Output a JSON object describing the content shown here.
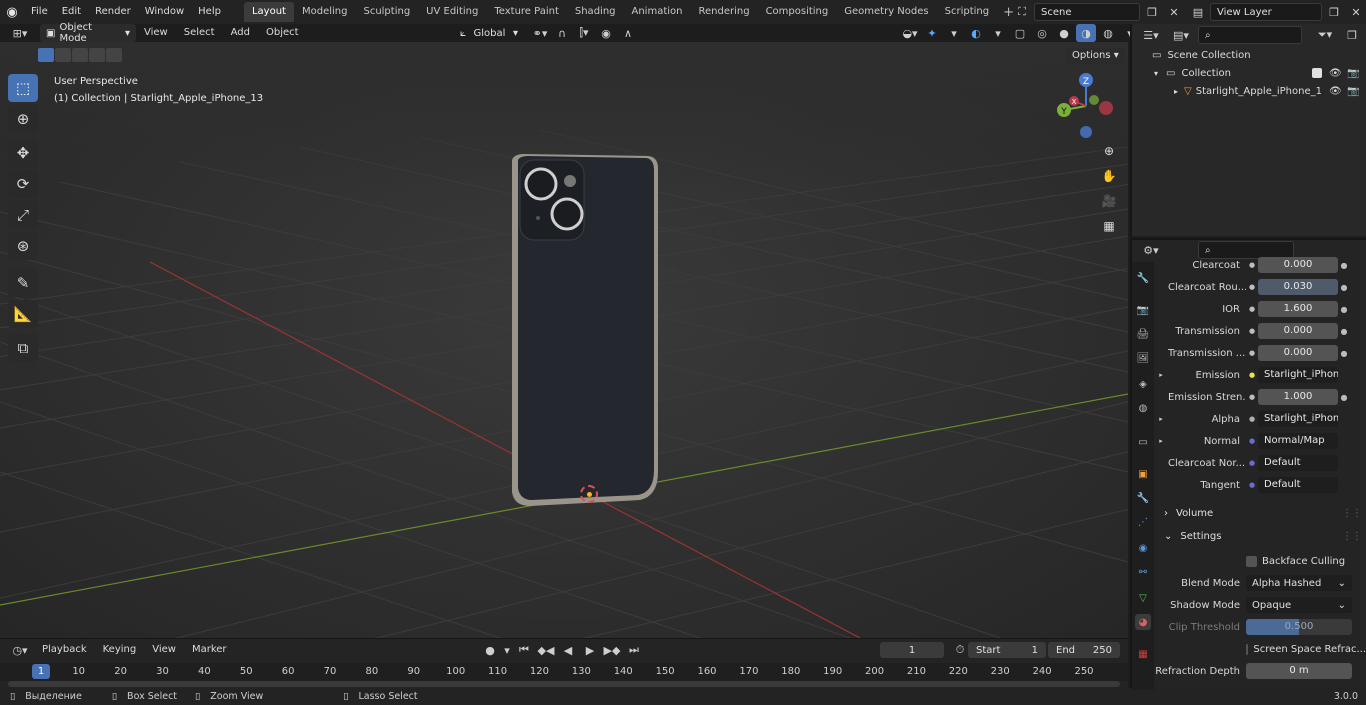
{
  "menu": [
    "File",
    "Edit",
    "Render",
    "Window",
    "Help"
  ],
  "workspaces": [
    "Layout",
    "Modeling",
    "Sculpting",
    "UV Editing",
    "Texture Paint",
    "Shading",
    "Animation",
    "Rendering",
    "Compositing",
    "Geometry Nodes",
    "Scripting"
  ],
  "active_workspace": "Layout",
  "scene_name": "Scene",
  "view_layer": "View Layer",
  "viewport": {
    "mode": "Object Mode",
    "menus": [
      "View",
      "Select",
      "Add",
      "Object"
    ],
    "transform": "Global",
    "options_label": "Options",
    "overlay_line1": "User Perspective",
    "overlay_line2": "(1) Collection | Starlight_Apple_iPhone_13",
    "gizmo": {
      "z": "Z",
      "y": "Y",
      "x": "X"
    }
  },
  "outliner": {
    "scene_collection": "Scene Collection",
    "collection": "Collection",
    "object": "Starlight_Apple_iPhone_1"
  },
  "properties": {
    "rows": [
      {
        "label": "Clearcoat",
        "value": "0.000",
        "kind": "num"
      },
      {
        "label": "Clearcoat Rou...",
        "value": "0.030",
        "kind": "num-hl"
      },
      {
        "label": "IOR",
        "value": "1.600",
        "kind": "num"
      },
      {
        "label": "Transmission",
        "value": "0.000",
        "kind": "num"
      },
      {
        "label": "Transmission ...",
        "value": "0.000",
        "kind": "num"
      },
      {
        "label": "Emission",
        "value": "Starlight_iPhone_...",
        "kind": "link",
        "dot": "#e6e24a"
      },
      {
        "label": "Emission Stren...",
        "value": "1.000",
        "kind": "num"
      },
      {
        "label": "Alpha",
        "value": "Starlight_iPhone_...",
        "kind": "link",
        "dot": "#b0b0b0"
      },
      {
        "label": "Normal",
        "value": "Normal/Map",
        "kind": "link",
        "dot": "#6b6bd6"
      },
      {
        "label": "Clearcoat Nor...",
        "value": "Default",
        "kind": "link",
        "dot": "#6b6bd6"
      },
      {
        "label": "Tangent",
        "value": "Default",
        "kind": "link",
        "dot": "#6b6bd6"
      }
    ],
    "volume_label": "Volume",
    "settings_label": "Settings",
    "backface_culling": "Backface Culling",
    "blend_mode_label": "Blend Mode",
    "blend_mode": "Alpha Hashed",
    "shadow_mode_label": "Shadow Mode",
    "shadow_mode": "Opaque",
    "clip_threshold_label": "Clip Threshold",
    "clip_threshold": "0.500",
    "ssr_label": "Screen Space Refrac...",
    "refraction_depth_label": "Refraction Depth",
    "refraction_depth": "0 m"
  },
  "timeline": {
    "menus": [
      "Playback",
      "Keying",
      "View",
      "Marker"
    ],
    "current_frame": "1",
    "start_label": "Start",
    "start": "1",
    "end_label": "End",
    "end": "250",
    "ruler": [
      "1",
      "10",
      "20",
      "30",
      "40",
      "50",
      "60",
      "70",
      "80",
      "90",
      "100",
      "110",
      "120",
      "130",
      "140",
      "150",
      "160",
      "170",
      "180",
      "190",
      "200",
      "210",
      "220",
      "230",
      "240",
      "250"
    ]
  },
  "status": {
    "item1": "Выделение",
    "item2": "Box Select",
    "item3": "Zoom View",
    "item4": "Lasso Select",
    "version": "3.0.0"
  }
}
